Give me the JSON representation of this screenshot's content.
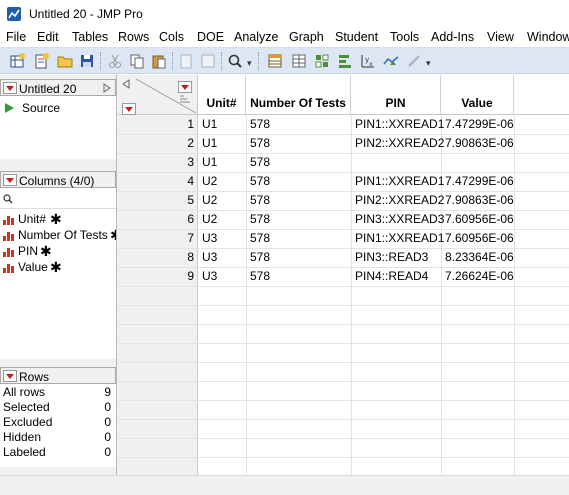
{
  "window": {
    "title": "Untitled 20 - JMP Pro"
  },
  "menu": [
    "File",
    "Edit",
    "Tables",
    "Rows",
    "Cols",
    "DOE",
    "Analyze",
    "Graph",
    "Student",
    "Tools",
    "Add-Ins",
    "View",
    "Window"
  ],
  "toolbar_icons": [
    "new-data-table-icon",
    "new-script-icon",
    "open-icon",
    "save-icon",
    "cut-icon",
    "copy-icon",
    "paste-icon",
    "journal-icon",
    "layout-icon",
    "search-icon",
    "data-table-icon",
    "distribution-icon",
    "fit-y-by-x-icon",
    "fit-model-icon",
    "graph-builder-icon",
    "control-chart-icon",
    "edit-icon"
  ],
  "table_panel": {
    "title": "Untitled 20",
    "items": [
      "Source"
    ]
  },
  "columns_panel": {
    "title": "Columns (4/0)",
    "search_placeholder": "",
    "columns": [
      {
        "name": "Unit#",
        "icon": "continuous-column-icon",
        "flag": "✱"
      },
      {
        "name": "Number Of Tests",
        "icon": "continuous-column-icon",
        "flag": "✱"
      },
      {
        "name": "PIN",
        "icon": "continuous-column-icon",
        "flag": "✱"
      },
      {
        "name": "Value",
        "icon": "continuous-column-icon",
        "flag": "✱"
      }
    ]
  },
  "rows_panel": {
    "title": "Rows",
    "stats": [
      {
        "label": "All rows",
        "value": "9"
      },
      {
        "label": "Selected",
        "value": "0"
      },
      {
        "label": "Excluded",
        "value": "0"
      },
      {
        "label": "Hidden",
        "value": "0"
      },
      {
        "label": "Labeled",
        "value": "0"
      }
    ]
  },
  "grid": {
    "headers": [
      "Unit#",
      "Number Of Tests",
      "PIN",
      "Value"
    ],
    "rows": [
      {
        "n": "1",
        "unit": "U1",
        "tests": "578",
        "pin": "PIN1::XXREAD1",
        "value": "7.47299E-06"
      },
      {
        "n": "2",
        "unit": "U1",
        "tests": "578",
        "pin": "PIN2::XXREAD2",
        "value": "7.90863E-06"
      },
      {
        "n": "3",
        "unit": "U1",
        "tests": "578",
        "pin": "",
        "value": ""
      },
      {
        "n": "4",
        "unit": "U2",
        "tests": "578",
        "pin": "PIN1::XXREAD1",
        "value": "7.47299E-06"
      },
      {
        "n": "5",
        "unit": "U2",
        "tests": "578",
        "pin": "PIN2::XXREAD2",
        "value": "7.90863E-06"
      },
      {
        "n": "6",
        "unit": "U2",
        "tests": "578",
        "pin": "PIN3::XXREAD3",
        "value": "7.60956E-06"
      },
      {
        "n": "7",
        "unit": "U3",
        "tests": "578",
        "pin": "PIN1::XXREAD1",
        "value": "7.60956E-06"
      },
      {
        "n": "8",
        "unit": "U3",
        "tests": "578",
        "pin": "PIN3::READ3",
        "value": "8.23364E-06"
      },
      {
        "n": "9",
        "unit": "U3",
        "tests": "578",
        "pin": "PIN4::READ4",
        "value": "7.26624E-06"
      }
    ]
  },
  "colors": {
    "accent_red": "#c81e1e",
    "toolbar_bg": "#dde7f3",
    "panel_bg": "#f0f0f0"
  }
}
